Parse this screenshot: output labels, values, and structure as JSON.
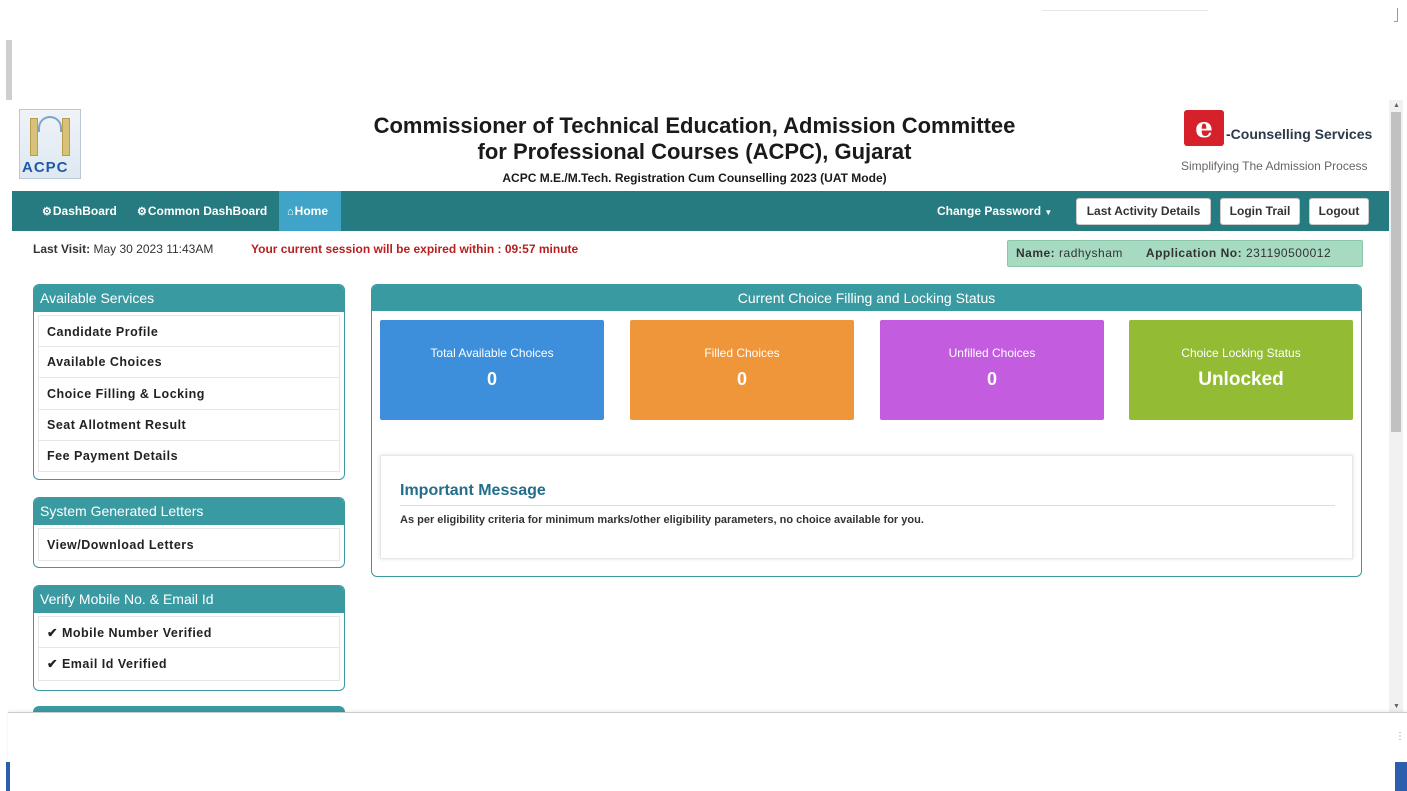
{
  "header": {
    "logo_text": "ACPC",
    "title_line1": "Commissioner of Technical Education, Admission Committee",
    "title_line2": "for Professional Courses (ACPC), Gujarat",
    "subtitle": "ACPC M.E./M.Tech. Registration Cum Counselling 2023 (UAT Mode)",
    "ecounselling": {
      "badge": "e",
      "label": "-Counselling Services",
      "tagline": "Simplifying The Admission Process"
    }
  },
  "navbar": {
    "items": [
      {
        "icon": "dashboard-icon",
        "label": "DashBoard"
      },
      {
        "icon": "dashboard-icon",
        "label": "Common DashBoard"
      },
      {
        "icon": "home-icon",
        "label": "Home"
      }
    ],
    "change_password": "Change Password",
    "last_activity": "Last Activity Details",
    "login_trail": "Login Trail",
    "logout": "Logout"
  },
  "status": {
    "last_visit_label": "Last Visit:",
    "last_visit_value": "May 30 2023 11:43AM",
    "session_text": "Your current session will be expired within : 09:57 minute",
    "name_label": "Name:",
    "name_value": "radhysham",
    "app_no_label": "Application No:",
    "app_no_value": "231190500012"
  },
  "sidebar": {
    "available_services": {
      "title": "Available Services",
      "items": [
        "Candidate Profile",
        "Available Choices",
        "Choice Filling & Locking",
        "Seat Allotment Result",
        "Fee Payment Details"
      ]
    },
    "letters": {
      "title": "System Generated Letters",
      "items": [
        "View/Download Letters"
      ]
    },
    "verify": {
      "title": "Verify Mobile No. & Email Id",
      "items": [
        "Mobile Number Verified",
        "Email Id Verified"
      ]
    }
  },
  "choice_status": {
    "title": "Current Choice Filling and Locking Status",
    "cards": [
      {
        "label": "Total Available Choices",
        "value": "0",
        "color": "#3d8fdc"
      },
      {
        "label": "Filled Choices",
        "value": "0",
        "color": "#f0963a"
      },
      {
        "label": "Unfilled Choices",
        "value": "0",
        "color": "#c45ce0"
      },
      {
        "label": "Choice Locking Status",
        "value": "Unlocked",
        "color": "#93bb33"
      }
    ]
  },
  "message": {
    "title": "Important Message",
    "body": "As per eligibility criteria for minimum marks/other eligibility parameters, no choice available for you."
  },
  "colors": {
    "navbar": "#267b80",
    "nav_active": "#3fa4c8",
    "panel_header": "#3a9aa2",
    "session_warning": "#b81f1f",
    "info_bg": "#a6dbc1"
  }
}
